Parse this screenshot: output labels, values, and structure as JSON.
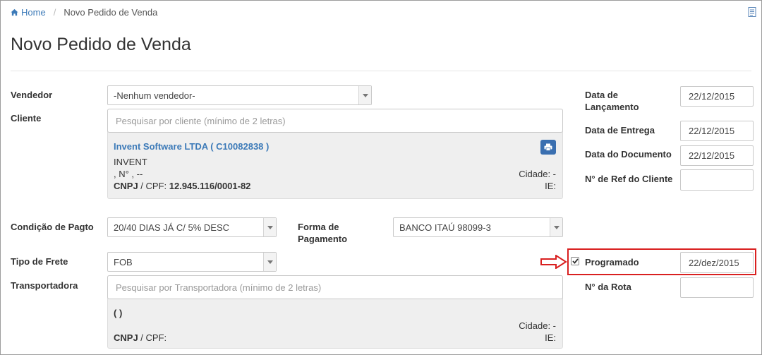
{
  "breadcrumb": {
    "home": "Home",
    "current": "Novo Pedido de Venda"
  },
  "page_title": "Novo Pedido de Venda",
  "form": {
    "vendedor": {
      "label": "Vendedor",
      "value": "-Nenhum vendedor-"
    },
    "cliente": {
      "label": "Cliente",
      "placeholder": "Pesquisar por cliente (mínimo de 2 letras)",
      "name": "Invent Software LTDA ( C10082838 )",
      "fantasia": "INVENT",
      "address": ", N° , --",
      "cidade": "Cidade: -",
      "ie": "IE:",
      "cnpj_label": "CNPJ",
      "cpf_label": " / CPF: ",
      "cnpj_value": "12.945.116/0001-82"
    },
    "condicao_pagto": {
      "label": "Condição de Pagto",
      "value": "20/40 DIAS JÁ C/ 5% DESC"
    },
    "forma_pagamento": {
      "label_line1": "Forma de",
      "label_line2": "Pagamento",
      "value": "BANCO ITAÚ 98099-3"
    },
    "tipo_frete": {
      "label": "Tipo de Frete",
      "value": "FOB"
    },
    "transportadora": {
      "label": "Transportadora",
      "placeholder": "Pesquisar por Transportadora (mínimo de 2 letras)",
      "name": "( )",
      "cidade": "Cidade: -",
      "ie": "IE:",
      "cnpj_label": "CNPJ",
      "cpf_label": " / CPF:"
    }
  },
  "dates": {
    "lancamento": {
      "label_line1": "Data de",
      "label_line2": "Lançamento",
      "value": "22/12/2015"
    },
    "entrega": {
      "label": "Data de Entrega",
      "value": "22/12/2015"
    },
    "documento": {
      "label": "Data do Documento",
      "value": "22/12/2015"
    },
    "ref_cliente": {
      "label": "N° de Ref do Cliente",
      "value": ""
    },
    "programado": {
      "label": "Programado",
      "checked": true,
      "value": "22/dez/2015"
    },
    "rota": {
      "label": "N° da Rota",
      "value": ""
    }
  },
  "colors": {
    "link": "#3c7ab8",
    "highlight": "#d92020",
    "button": "#3a6fb0"
  }
}
